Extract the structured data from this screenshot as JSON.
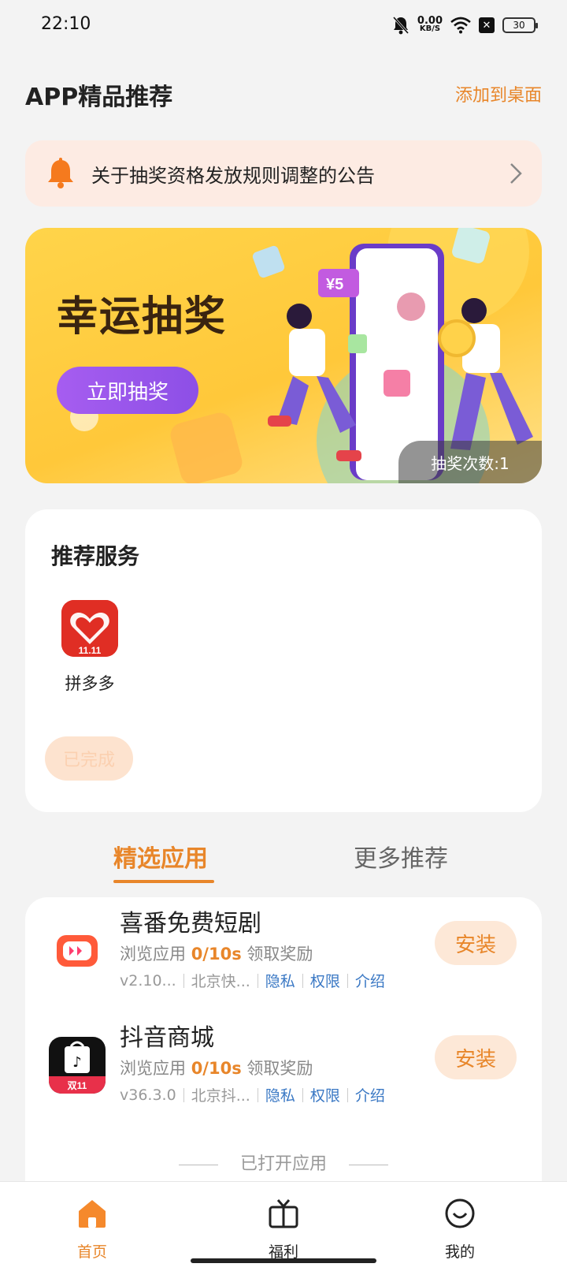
{
  "status_bar": {
    "time": "22:10",
    "net_speed_value": "0.00",
    "net_speed_unit": "KB/S",
    "battery": "30"
  },
  "header": {
    "title": "APP精品推荐",
    "action": "添加到桌面"
  },
  "notice": {
    "text": "关于抽奖资格发放规则调整的公告"
  },
  "lottery": {
    "title": "幸运抽奖",
    "button": "立即抽奖",
    "count_label": "抽奖次数:1",
    "coupon": "¥5"
  },
  "services": {
    "title": "推荐服务",
    "apps": [
      {
        "name": "拼多多",
        "badge": "11.11"
      }
    ],
    "status_pill": "已完成"
  },
  "tabs": [
    {
      "label": "精选应用",
      "active": true
    },
    {
      "label": "更多推荐",
      "active": false
    }
  ],
  "apps": [
    {
      "name": "喜番免费短剧",
      "reward_prefix": "浏览应用 ",
      "reward_progress": "0/10s",
      "reward_suffix": " 领取奖励",
      "version": "v2.10...",
      "developer": "北京快...",
      "privacy": "隐私",
      "permissions": "权限",
      "intro": "介绍",
      "button": "安装"
    },
    {
      "name": "抖音商城",
      "badge": "双11",
      "reward_prefix": "浏览应用 ",
      "reward_progress": "0/10s",
      "reward_suffix": " 领取奖励",
      "version": "v36.3.0",
      "developer": "北京抖...",
      "privacy": "隐私",
      "permissions": "权限",
      "intro": "介绍",
      "button": "安装"
    }
  ],
  "opened_divider": "已打开应用",
  "bottom_nav": [
    {
      "label": "首页",
      "icon": "home-icon",
      "active": true
    },
    {
      "label": "福利",
      "icon": "gift-tv-icon",
      "active": false
    },
    {
      "label": "我的",
      "icon": "smile-icon",
      "active": false
    }
  ],
  "colors": {
    "accent": "#e8862a",
    "link": "#3a78c4",
    "banner": "#ffc83a",
    "cta_purple": "#8d4fe6",
    "pinduoduo_red": "#e02e24"
  }
}
